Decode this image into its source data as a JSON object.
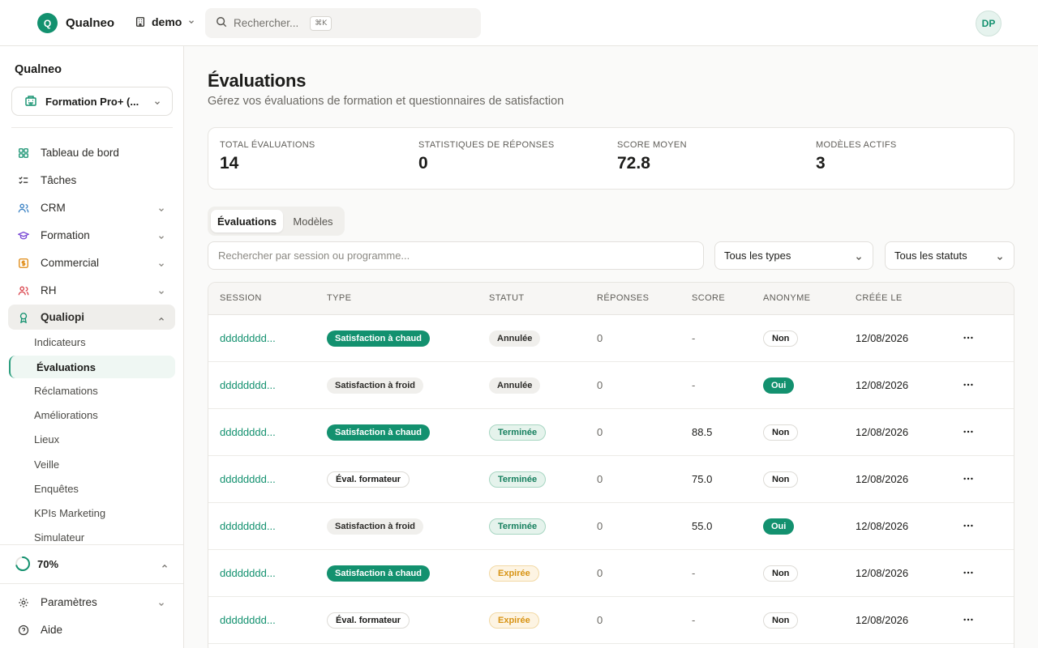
{
  "app": {
    "logo_letter": "Q",
    "name": "Qualneo"
  },
  "org": {
    "label": "demo"
  },
  "search": {
    "placeholder": "Rechercher...",
    "shortcut": "⌘K"
  },
  "user": {
    "initials": "DP"
  },
  "sidebar": {
    "title": "Qualneo",
    "workspace": "Formation Pro+ (...",
    "nav": [
      {
        "label": "Tableau de bord"
      },
      {
        "label": "Tâches"
      },
      {
        "label": "CRM"
      },
      {
        "label": "Formation"
      },
      {
        "label": "Commercial"
      },
      {
        "label": "RH"
      },
      {
        "label": "Qualiopi"
      }
    ],
    "qualiopi_items": [
      "Indicateurs",
      "Évaluations",
      "Réclamations",
      "Améliorations",
      "Lieux",
      "Veille",
      "Enquêtes",
      "KPIs Marketing",
      "Simulateur"
    ],
    "progress": {
      "value": 0.7,
      "label": "70%"
    },
    "settings": "Paramètres",
    "help": "Aide"
  },
  "page": {
    "title": "Évaluations",
    "subtitle": "Gérez vos évaluations de formation et questionnaires de satisfaction"
  },
  "stats": [
    {
      "label": "TOTAL ÉVALUATIONS",
      "value": "14"
    },
    {
      "label": "STATISTIQUES DE RÉPONSES",
      "value": "0"
    },
    {
      "label": "SCORE MOYEN",
      "value": "72.8"
    },
    {
      "label": "MODÈLES ACTIFS",
      "value": "3"
    }
  ],
  "tabs": [
    {
      "label": "Évaluations",
      "active": true
    },
    {
      "label": "Modèles",
      "active": false
    }
  ],
  "filters": {
    "search_placeholder": "Rechercher par session ou programme...",
    "type_select": "Tous les types",
    "status_select": "Tous les statuts"
  },
  "table": {
    "columns": [
      "SESSION",
      "TYPE",
      "STATUT",
      "RÉPONSES",
      "SCORE",
      "ANONYME",
      "CRÉÉE LE"
    ],
    "rows": [
      {
        "session": "dddddddd...",
        "type": "Satisfaction à chaud",
        "status": "Annulée",
        "responses": "0",
        "score": "-",
        "anonymous": "Non",
        "created": "12/08/2026"
      },
      {
        "session": "dddddddd...",
        "type": "Satisfaction à froid",
        "status": "Annulée",
        "responses": "0",
        "score": "-",
        "anonymous": "Oui",
        "created": "12/08/2026"
      },
      {
        "session": "dddddddd...",
        "type": "Satisfaction à chaud",
        "status": "Terminée",
        "responses": "0",
        "score": "88.5",
        "anonymous": "Non",
        "created": "12/08/2026"
      },
      {
        "session": "dddddddd...",
        "type": "Éval. formateur",
        "status": "Terminée",
        "responses": "0",
        "score": "75.0",
        "anonymous": "Non",
        "created": "12/08/2026"
      },
      {
        "session": "dddddddd...",
        "type": "Satisfaction à froid",
        "status": "Terminée",
        "responses": "0",
        "score": "55.0",
        "anonymous": "Oui",
        "created": "12/08/2026"
      },
      {
        "session": "dddddddd...",
        "type": "Satisfaction à chaud",
        "status": "Expirée",
        "responses": "0",
        "score": "-",
        "anonymous": "Non",
        "created": "12/08/2026"
      },
      {
        "session": "dddddddd...",
        "type": "Éval. formateur",
        "status": "Expirée",
        "responses": "0",
        "score": "-",
        "anonymous": "Non",
        "created": "12/08/2026"
      }
    ]
  },
  "colors": {
    "accent": "#13916f",
    "warning": "#d89416",
    "border": "#e7e5e1"
  }
}
